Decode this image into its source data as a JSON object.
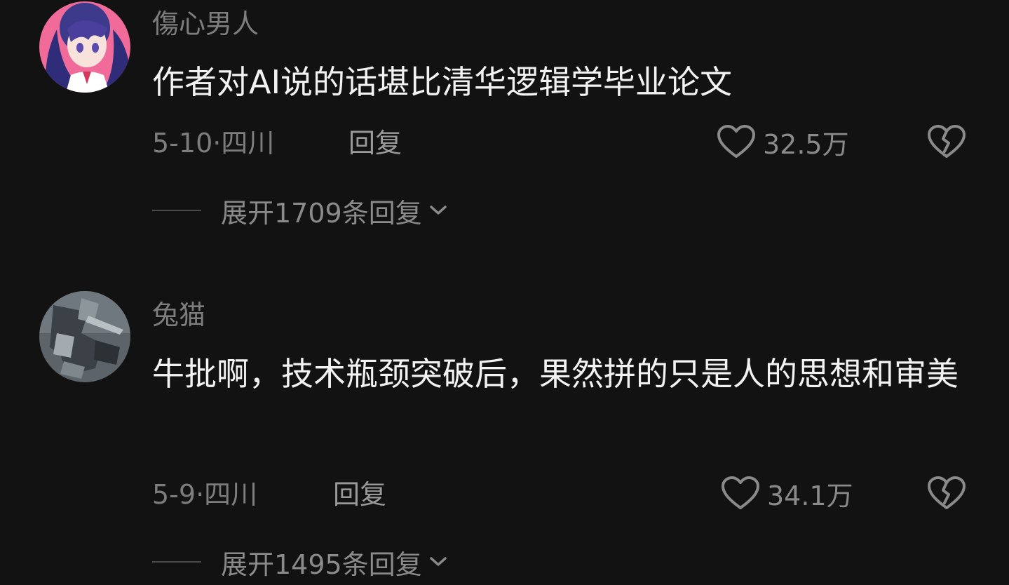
{
  "comments": [
    {
      "username": "傷心男人",
      "content": "作者对AI说的话堪比清华逻辑学毕业论文",
      "date_location": "5-10·四川",
      "reply_label": "回复",
      "likes": "32.5万",
      "expand_label": "展开1709条回复"
    },
    {
      "username": "兔猫",
      "content": "牛批啊，技术瓶颈突破后，果然拼的只是人的思想和审美",
      "date_location": "5-9·四川",
      "reply_label": "回复",
      "likes": "34.1万",
      "expand_label": "展开1495条回复"
    }
  ],
  "icons": {
    "like": "heart-outline-icon",
    "dislike": "broken-heart-icon",
    "expand": "chevron-down-icon"
  },
  "colors": {
    "background": "#121212",
    "text_primary": "#f2f2f2",
    "text_secondary": "#7d7d7d"
  }
}
